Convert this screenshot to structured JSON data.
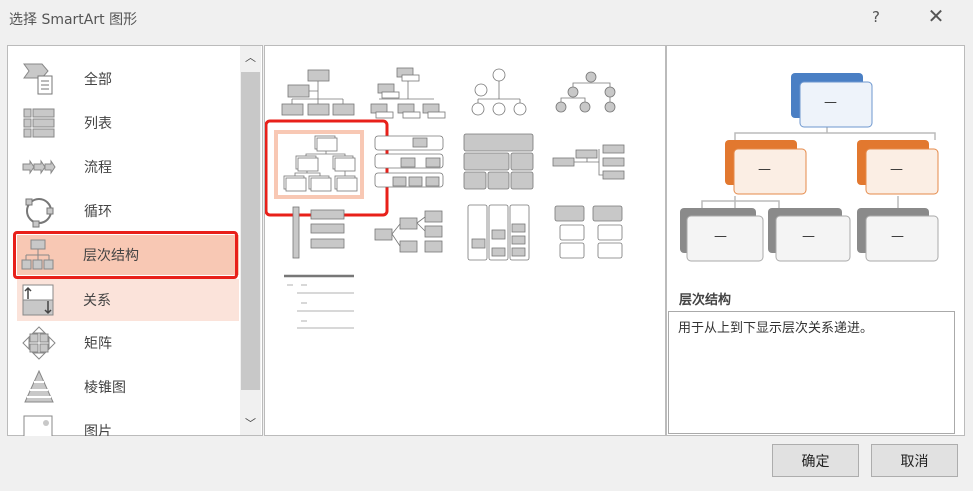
{
  "dialog": {
    "title": "选择 SmartArt 图形",
    "help_icon": "?",
    "close_icon": "✕"
  },
  "categories": [
    {
      "label": "全部",
      "icon": "all-icon"
    },
    {
      "label": "列表",
      "icon": "list-icon"
    },
    {
      "label": "流程",
      "icon": "process-icon"
    },
    {
      "label": "循环",
      "icon": "cycle-icon"
    },
    {
      "label": "层次结构",
      "icon": "hierarchy-icon",
      "selected": true
    },
    {
      "label": "关系",
      "icon": "relationship-icon",
      "hover": true
    },
    {
      "label": "矩阵",
      "icon": "matrix-icon"
    },
    {
      "label": "棱锥图",
      "icon": "pyramid-icon"
    },
    {
      "label": "图片",
      "icon": "picture-icon"
    }
  ],
  "preview": {
    "title": "层次结构",
    "description": "用于从上到下显示层次关系递进。",
    "placeholder": "—"
  },
  "buttons": {
    "ok": "确定",
    "cancel": "取消"
  },
  "colors": {
    "highlight": "#f8c8b4",
    "hover": "#fbe3da",
    "annotation": "#e8201a",
    "blue": "#4a7fc4",
    "orange": "#e2782f"
  }
}
